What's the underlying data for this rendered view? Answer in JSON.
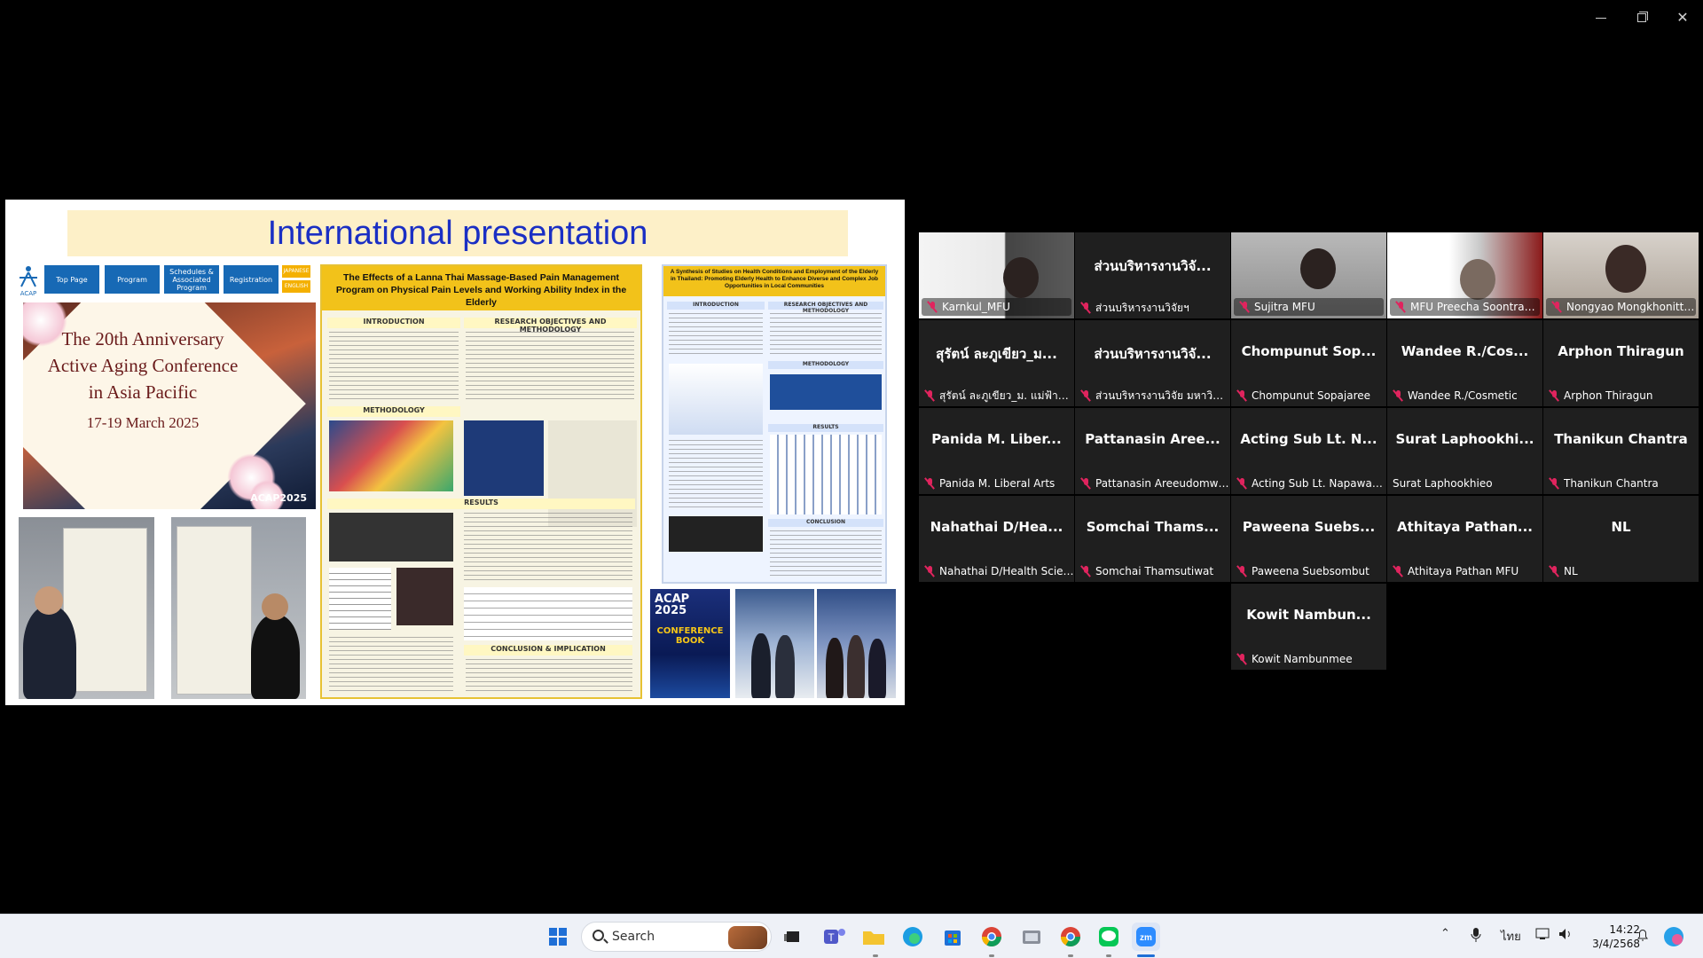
{
  "window": {
    "controls": [
      "minimize",
      "restore",
      "close"
    ]
  },
  "slide": {
    "title": "International presentation",
    "acap_site": {
      "nav": [
        "Top Page",
        "Program",
        "Schedules & Associated Program",
        "Registration"
      ],
      "languages": [
        "JAPANESE",
        "ENGLISH"
      ],
      "logo_text": "ACAP",
      "banner_line1": "The 20th Anniversary",
      "banner_line2": "Active Aging Conference",
      "banner_line3": "in Asia Pacific",
      "banner_date": "17-19 March 2025",
      "banner_tag": "ACAP2025"
    },
    "poster1": {
      "title": "The Effects of a Lanna Thai Massage-Based Pain Management Program on Physical Pain Levels and Working Ability Index in the Elderly",
      "sections": [
        "INTRODUCTION",
        "RESEARCH OBJECTIVES AND METHODOLOGY",
        "METHODOLOGY",
        "RESULTS",
        "CONCLUSION & IMPLICATION"
      ]
    },
    "poster2": {
      "title": "A Synthesis of Studies on Health Conditions and Employment of the Elderly in Thailand: Promoting Elderly Health to Enhance Diverse and Complex Job Opportunities in Local Communities",
      "sections": [
        "INTRODUCTION",
        "RESEARCH OBJECTIVES AND METHODOLOGY",
        "METHODOLOGY",
        "RESULTS",
        "CONCLUSION"
      ]
    },
    "conference_book": {
      "line1": "ACAP",
      "line2": "2025",
      "line3": "CONFERENCE BOOK"
    }
  },
  "participants": [
    {
      "display": "",
      "label": "Karnkul_MFU",
      "video": true
    },
    {
      "display": "ส่วนบริหารงานวิจั...",
      "label": "ส่วนบริหารงานวิจัยฯ",
      "video": false
    },
    {
      "display": "",
      "label": "Sujitra MFU",
      "video": true
    },
    {
      "display": "",
      "label": "MFU Preecha Soontranan",
      "video": true
    },
    {
      "display": "",
      "label": "Nongyao Mongkhonittivech",
      "video": true,
      "active": true
    },
    {
      "display": "สุรัตน์ ละภูเขียว_ม...",
      "label": "สุรัตน์ ละภูเขียว_ม. แม่ฟ้าหลวง",
      "video": false
    },
    {
      "display": "ส่วนบริหารงานวิจั...",
      "label": "ส่วนบริหารงานวิจัย มหาวิทย...",
      "video": false
    },
    {
      "display": "Chompunut Sop...",
      "label": "Chompunut Sopajaree",
      "video": false
    },
    {
      "display": "Wandee R./Cos...",
      "label": "Wandee R./Cosmetic",
      "video": false
    },
    {
      "display": "Arphon Thiragun",
      "label": "Arphon Thiragun",
      "video": false
    },
    {
      "display": "Panida M. Liber...",
      "label": "Panida M. Liberal Arts",
      "video": false
    },
    {
      "display": "Pattanasin Aree...",
      "label": "Pattanasin Areeudomwo...",
      "video": false
    },
    {
      "display": "Acting Sub Lt. N...",
      "label": "Acting Sub Lt. Napawat ...",
      "video": false
    },
    {
      "display": "Surat Laphookhi...",
      "label": "Surat Laphookhieo",
      "video": false,
      "muted": false
    },
    {
      "display": "Thanikun Chantra",
      "label": "Thanikun Chantra",
      "video": false
    },
    {
      "display": "Nahathai D/Hea...",
      "label": "Nahathai D/Health Scien...",
      "video": false
    },
    {
      "display": "Somchai Thams...",
      "label": "Somchai Thamsutiwat",
      "video": false
    },
    {
      "display": "Paweena Suebs...",
      "label": "Paweena Suebsombut",
      "video": false
    },
    {
      "display": "Athitaya Pathan...",
      "label": "Athitaya Pathan MFU",
      "video": false
    },
    {
      "display": "NL",
      "label": "NL",
      "video": false
    },
    {
      "display": "Kowit Nambun...",
      "label": "Kowit Nambunmee",
      "video": false
    }
  ],
  "taskbar": {
    "search_placeholder": "Search",
    "language": "ไทย",
    "time": "14:22",
    "date": "3/4/2568"
  },
  "colors": {
    "mic_muted": "#e0245e",
    "active_speaker": "#23d18b",
    "slide_title": "#1a2fc4",
    "poster_header": "#f2c21a"
  }
}
